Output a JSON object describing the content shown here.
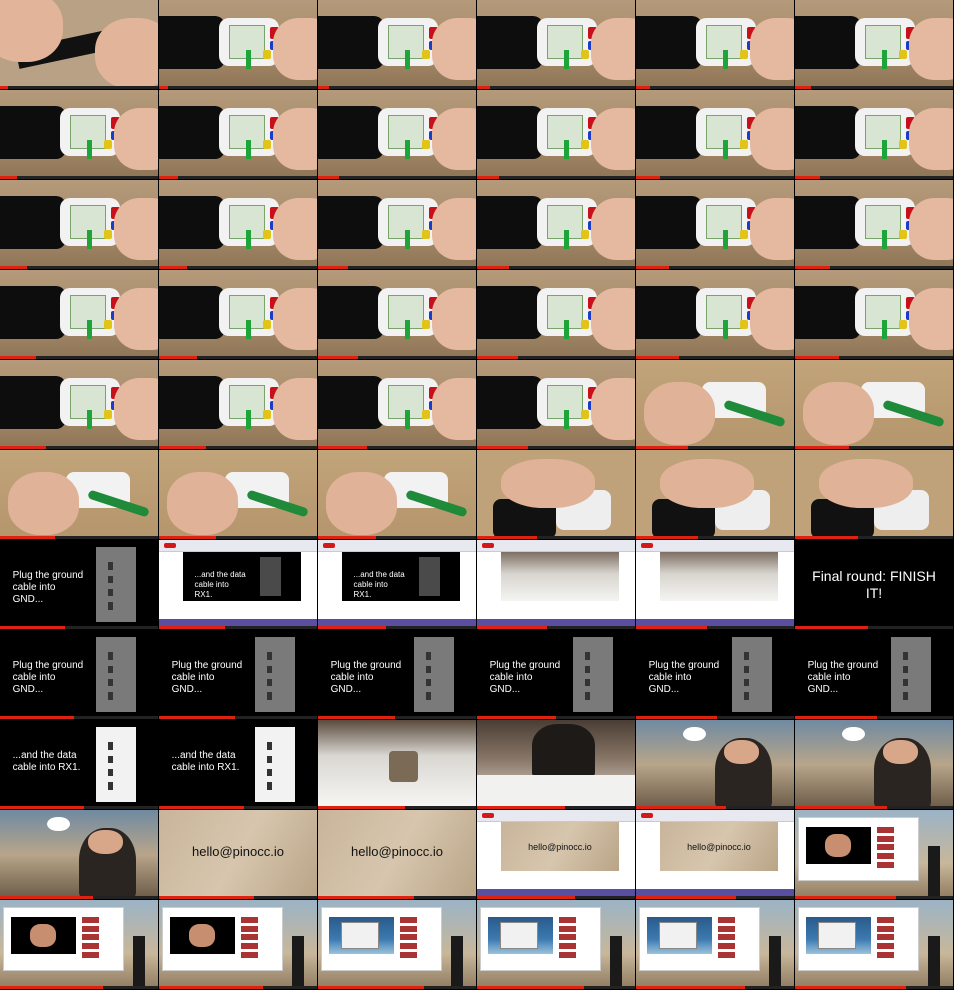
{
  "grid": {
    "cols": 6,
    "rows": 11
  },
  "colors": {
    "wood": "#a58a67",
    "hand": "#e3b9a0",
    "board": "#d7e7cf",
    "black": "#0c0c0c",
    "bar": "#d21818",
    "gallery_sky": "#9bb3c6",
    "browser": "#ffffff"
  },
  "captions": {
    "ground": "Plug the ground cable into GND...",
    "data": "...and the data cable into RX1.",
    "final": "Final round: FINISH IT!",
    "email": "hello@pinocc.io"
  },
  "thumbnails": [
    {
      "kind": "hands-strap",
      "progress": 0.05
    },
    {
      "kind": "device",
      "progress": 0.06
    },
    {
      "kind": "device",
      "progress": 0.07
    },
    {
      "kind": "device",
      "progress": 0.08
    },
    {
      "kind": "device",
      "progress": 0.09
    },
    {
      "kind": "device",
      "progress": 0.1
    },
    {
      "kind": "device",
      "progress": 0.11
    },
    {
      "kind": "device",
      "progress": 0.12
    },
    {
      "kind": "device",
      "progress": 0.13
    },
    {
      "kind": "device",
      "progress": 0.14
    },
    {
      "kind": "device",
      "progress": 0.15
    },
    {
      "kind": "device",
      "progress": 0.16
    },
    {
      "kind": "device",
      "progress": 0.17
    },
    {
      "kind": "device",
      "progress": 0.18
    },
    {
      "kind": "device",
      "progress": 0.19
    },
    {
      "kind": "device",
      "progress": 0.2
    },
    {
      "kind": "device",
      "progress": 0.21
    },
    {
      "kind": "device",
      "progress": 0.22
    },
    {
      "kind": "device",
      "progress": 0.23
    },
    {
      "kind": "device",
      "progress": 0.24
    },
    {
      "kind": "device",
      "progress": 0.25
    },
    {
      "kind": "device",
      "progress": 0.26
    },
    {
      "kind": "device",
      "progress": 0.27
    },
    {
      "kind": "device",
      "progress": 0.28
    },
    {
      "kind": "device",
      "progress": 0.29
    },
    {
      "kind": "device",
      "progress": 0.3
    },
    {
      "kind": "device",
      "progress": 0.31
    },
    {
      "kind": "device",
      "progress": 0.32
    },
    {
      "kind": "solder",
      "progress": 0.33
    },
    {
      "kind": "solder",
      "progress": 0.34
    },
    {
      "kind": "solder",
      "progress": 0.35
    },
    {
      "kind": "solder",
      "progress": 0.36
    },
    {
      "kind": "solder",
      "progress": 0.37
    },
    {
      "kind": "assembly",
      "progress": 0.38
    },
    {
      "kind": "assembly",
      "progress": 0.39
    },
    {
      "kind": "assembly",
      "progress": 0.4
    },
    {
      "kind": "slide-ground",
      "progress": 0.41
    },
    {
      "kind": "browser-data",
      "progress": 0.42
    },
    {
      "kind": "browser-data",
      "progress": 0.43
    },
    {
      "kind": "browser-robot",
      "progress": 0.44
    },
    {
      "kind": "browser-robot",
      "progress": 0.45
    },
    {
      "kind": "slide-final",
      "progress": 0.46
    },
    {
      "kind": "slide-ground",
      "progress": 0.47
    },
    {
      "kind": "slide-ground",
      "progress": 0.48
    },
    {
      "kind": "slide-ground",
      "progress": 0.49
    },
    {
      "kind": "slide-ground",
      "progress": 0.5
    },
    {
      "kind": "slide-ground",
      "progress": 0.51
    },
    {
      "kind": "slide-ground",
      "progress": 0.52
    },
    {
      "kind": "slide-data",
      "progress": 0.53
    },
    {
      "kind": "slide-data",
      "progress": 0.54
    },
    {
      "kind": "robot-table",
      "progress": 0.55
    },
    {
      "kind": "people-table",
      "progress": 0.56
    },
    {
      "kind": "gallery",
      "progress": 0.57
    },
    {
      "kind": "gallery",
      "progress": 0.58
    },
    {
      "kind": "gallery",
      "progress": 0.59
    },
    {
      "kind": "wood-email",
      "progress": 0.6
    },
    {
      "kind": "wood-email",
      "progress": 0.61
    },
    {
      "kind": "browser-email",
      "progress": 0.62
    },
    {
      "kind": "browser-email",
      "progress": 0.63
    },
    {
      "kind": "browser-stage",
      "progress": 0.64
    },
    {
      "kind": "browser-stage",
      "progress": 0.65
    },
    {
      "kind": "browser-stage",
      "progress": 0.66
    },
    {
      "kind": "browser-ocean",
      "progress": 0.67
    },
    {
      "kind": "browser-ocean",
      "progress": 0.68
    },
    {
      "kind": "browser-ocean",
      "progress": 0.69
    },
    {
      "kind": "browser-ocean",
      "progress": 0.7
    }
  ]
}
